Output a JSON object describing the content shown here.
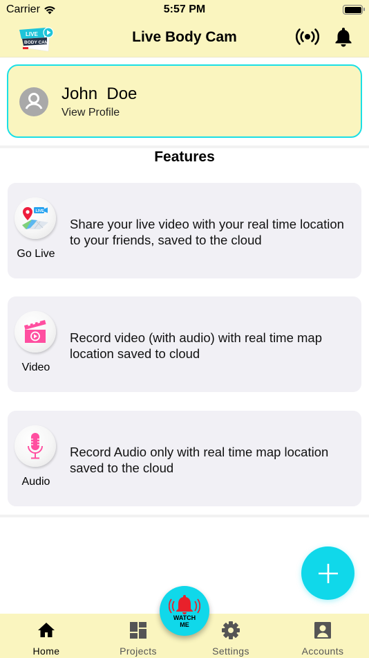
{
  "status_bar": {
    "carrier": "Carrier",
    "time": "5:57 PM",
    "battery_level": 1.0
  },
  "nav": {
    "title": "Live Body Cam",
    "logo": {
      "line1": "LIVE",
      "line2": "BODY CAM"
    },
    "icons": [
      "live-broadcast-icon",
      "bell-icon"
    ]
  },
  "profile": {
    "name": "John  Doe",
    "subtitle": "View Profile"
  },
  "features": {
    "title": "Features",
    "items": [
      {
        "label": "Go Live",
        "icon": "map-live-icon",
        "description": "Share your live video with your real time location to your friends, saved to the cloud"
      },
      {
        "label": "Video",
        "icon": "video-clapper-icon",
        "description": "Record video (with audio) with real time map location saved to cloud"
      },
      {
        "label": "Audio",
        "icon": "microphone-icon",
        "description": "Record Audio only with real time map location saved to the cloud"
      }
    ]
  },
  "fab": {
    "icon": "plus-icon"
  },
  "watch_me": {
    "line1": "WATCH",
    "line2": "ME"
  },
  "tabbar": {
    "items": [
      {
        "label": "Home",
        "icon": "home-icon",
        "active": true
      },
      {
        "label": "Projects",
        "icon": "dashboard-icon",
        "active": false
      },
      {
        "label": "Settings",
        "icon": "gear-icon",
        "active": false
      },
      {
        "label": "Accounts",
        "icon": "account-box-icon",
        "active": false
      }
    ]
  },
  "colors": {
    "header_bg": "#faf5bf",
    "accent_cyan": "#10d8ea",
    "card_bg": "#f1f0f5",
    "feature_pink": "#ff4fa0",
    "alarm_red": "#e8212b"
  }
}
